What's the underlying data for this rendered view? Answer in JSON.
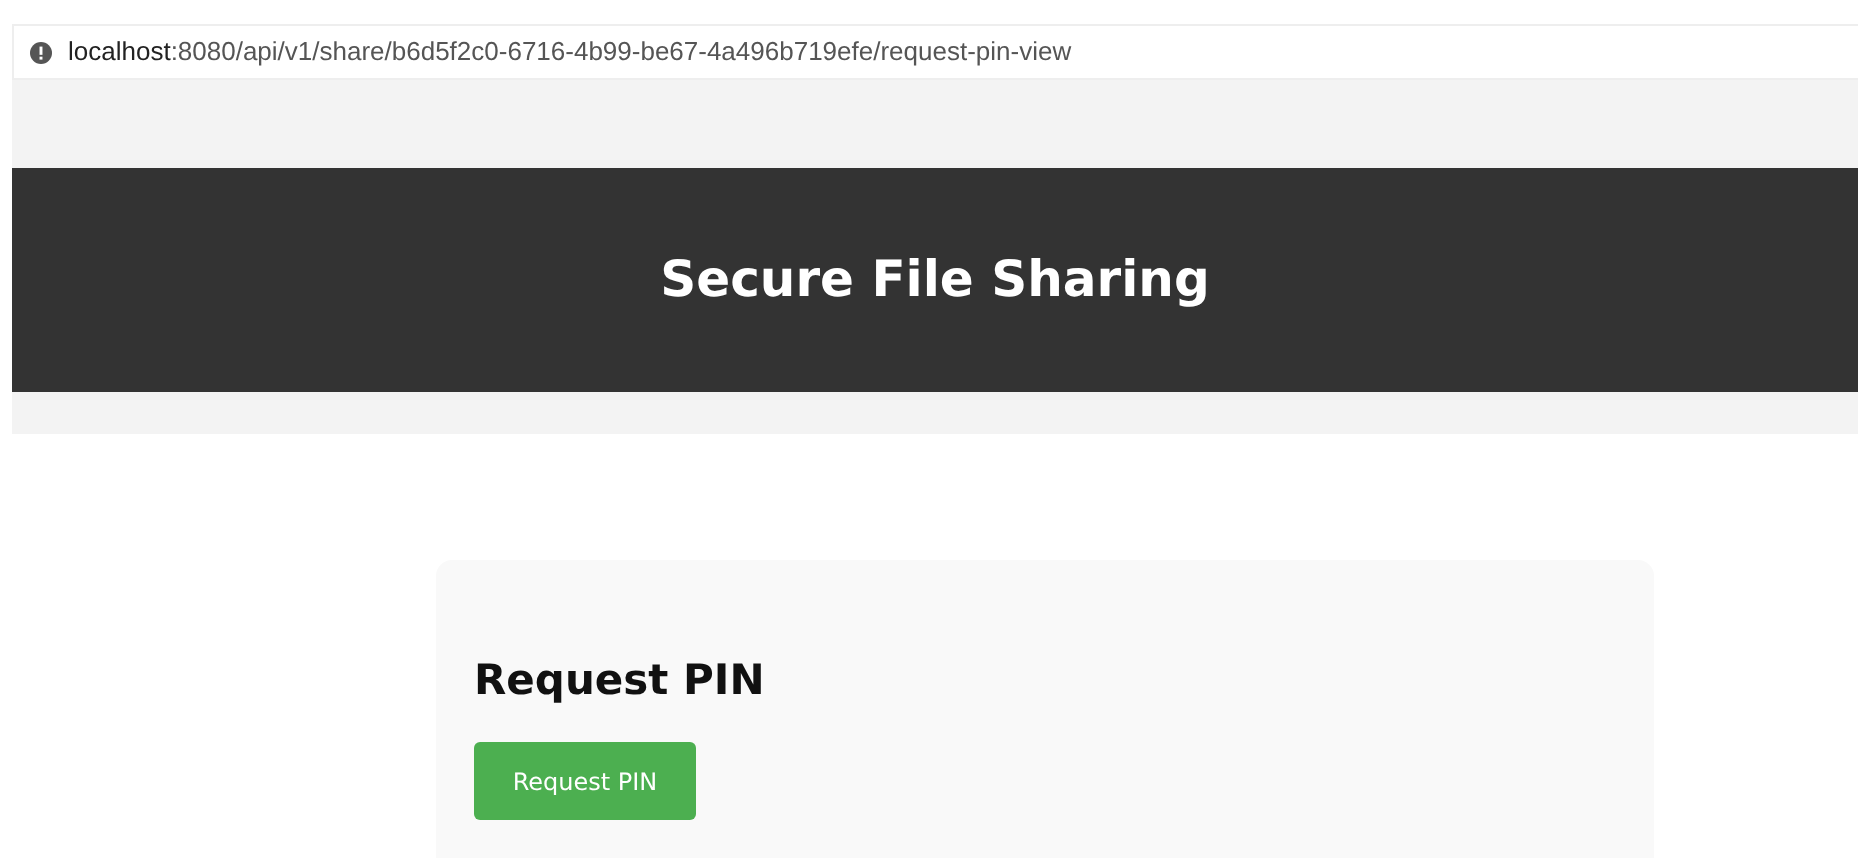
{
  "address_bar": {
    "host": "localhost",
    "path": ":8080/api/v1/share/b6d5f2c0-6716-4b99-be67-4a496b719efe/request-pin-view"
  },
  "header": {
    "title": "Secure File Sharing"
  },
  "card": {
    "title": "Request PIN",
    "button": "Request PIN"
  }
}
